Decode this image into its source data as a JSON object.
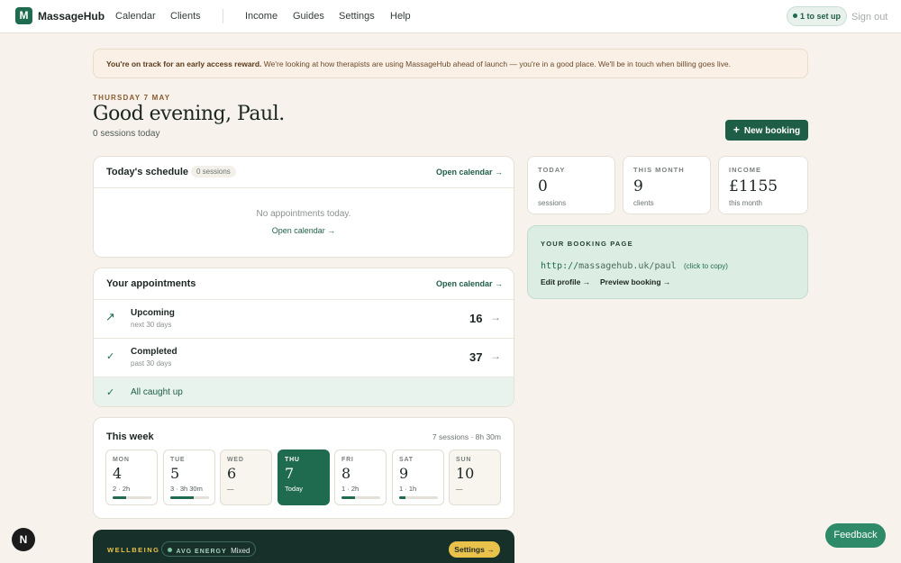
{
  "nav": {
    "logo_letter": "M",
    "brand": "MassageHub",
    "links": [
      "Calendar",
      "Clients",
      "Income",
      "Guides",
      "Settings",
      "Help"
    ],
    "setup_label": "1 to set up",
    "signout": "Sign out"
  },
  "banner": {
    "bold": "You're on track for an early access reward.",
    "text": " We're looking at how therapists are using MassageHub ahead of launch — you're in a good place. We'll be in touch when billing goes live."
  },
  "header": {
    "date": "THURSDAY 7 MAY",
    "greeting": "Good evening, Paul.",
    "sessions_today": "0 sessions today",
    "new_booking": "New booking",
    "new_booking_icon": "+"
  },
  "schedule": {
    "title": "Today's schedule",
    "count": "0 sessions",
    "open_calendar": "Open calendar →",
    "empty": "No appointments today.",
    "empty_link": "Open calendar →"
  },
  "appointments": {
    "title": "Your appointments",
    "open_calendar": "Open calendar →",
    "rows": [
      {
        "icon": "↗",
        "label": "Upcoming",
        "sub": "next 30 days",
        "count": "16",
        "arrow": "→"
      },
      {
        "icon": "✓",
        "label": "Completed",
        "sub": "past 30 days",
        "count": "37",
        "arrow": "→"
      }
    ],
    "caught_up_icon": "✓",
    "caught_up": "All caught up"
  },
  "week": {
    "title": "This week",
    "summary": "7 sessions · 8h 30m",
    "days": [
      {
        "name": "MON",
        "date": "4",
        "meta": "2 · 2h",
        "progress": 0.35,
        "state": "normal"
      },
      {
        "name": "TUE",
        "date": "5",
        "meta": "3 · 3h 30m",
        "progress": 0.6,
        "state": "normal"
      },
      {
        "name": "WED",
        "date": "6",
        "meta": "—",
        "progress": 0,
        "state": "past"
      },
      {
        "name": "THU",
        "date": "7",
        "meta": "Today",
        "progress": 0,
        "state": "today"
      },
      {
        "name": "FRI",
        "date": "8",
        "meta": "1 · 2h",
        "progress": 0.35,
        "state": "normal"
      },
      {
        "name": "SAT",
        "date": "9",
        "meta": "1 · 1h",
        "progress": 0.17,
        "state": "normal"
      },
      {
        "name": "SUN",
        "date": "10",
        "meta": "—",
        "progress": 0,
        "state": "past"
      }
    ]
  },
  "stats": [
    {
      "label": "TODAY",
      "value": "0",
      "caption": "sessions"
    },
    {
      "label": "THIS MONTH",
      "value": "9",
      "caption": "clients"
    },
    {
      "label": "INCOME",
      "value": "£1155",
      "caption": "this month"
    }
  ],
  "booking_page": {
    "label": "YOUR BOOKING PAGE",
    "url_scheme": "http://",
    "url_rest": "massagehub.uk/paul",
    "copy_hint": "(click to copy)",
    "edit_profile": "Edit profile →",
    "preview": "Preview booking →"
  },
  "wellbeing": {
    "label": "WELLBEING",
    "energy_label": "AVG ENERGY",
    "energy_value": "Mixed",
    "settings": "Settings →"
  },
  "feedback": "Feedback",
  "badge": "N",
  "colors": {
    "brand": "#1f6b50",
    "accent_dark": "#1f5e46",
    "background": "#f7f3ec"
  }
}
